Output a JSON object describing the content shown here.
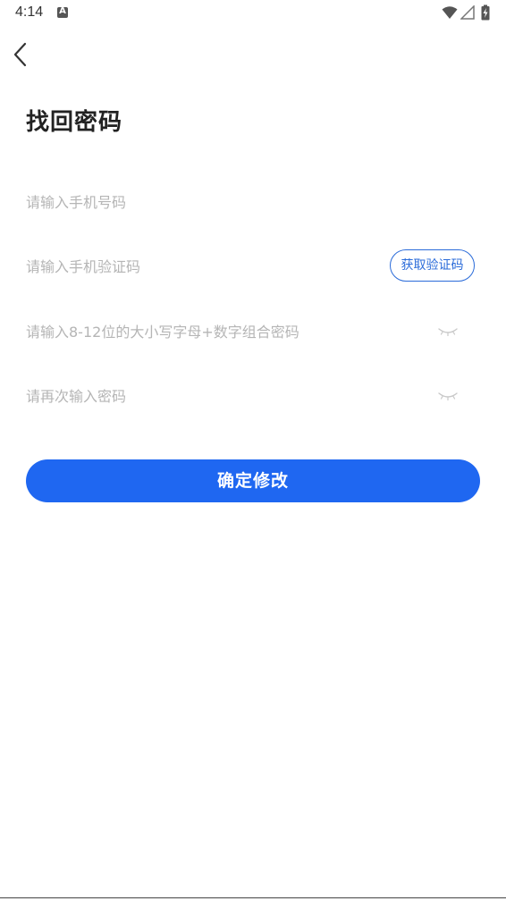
{
  "status_bar": {
    "time": "4:14",
    "notification_icon": "a-icon",
    "notification_letter": "A",
    "icons": [
      "wifi-icon",
      "signal-icon",
      "battery-charging-icon"
    ]
  },
  "header": {
    "back_icon": "chevron-left-icon"
  },
  "page": {
    "title": "找回密码"
  },
  "form": {
    "phone_placeholder": "请输入手机号码",
    "phone_value": "",
    "code_placeholder": "请输入手机验证码",
    "code_value": "",
    "get_code_label": "获取验证码",
    "password_placeholder": "请输入8-12位的大小写字母+数字组合密码",
    "password_value": "",
    "confirm_placeholder": "请再次输入密码",
    "confirm_value": "",
    "eye_icon": "eye-closed-icon"
  },
  "actions": {
    "submit_label": "确定修改"
  },
  "colors": {
    "accent": "#1f67f1",
    "link": "#2a6bd9",
    "placeholder": "#b5b5b5"
  }
}
